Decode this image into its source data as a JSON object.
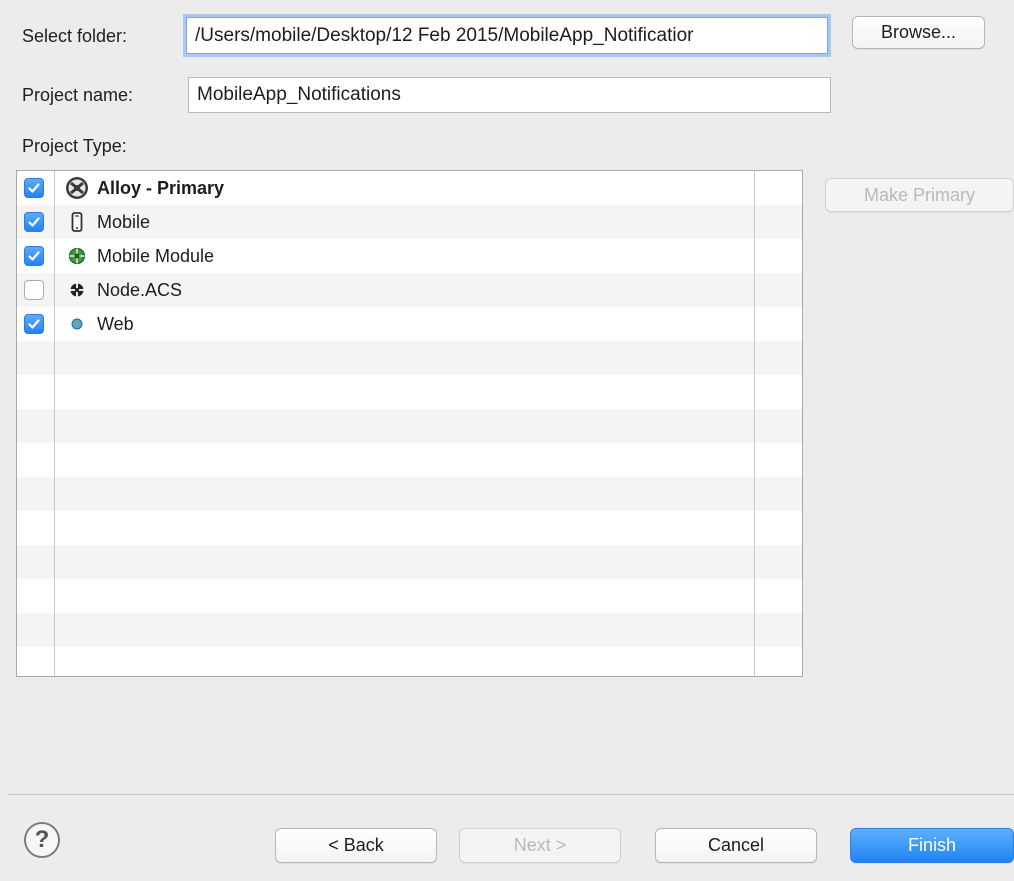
{
  "form": {
    "select_folder_label": "Select folder:",
    "folder_path": "/Users/mobile/Desktop/12 Feb 2015/MobileApp_Notificatior",
    "browse_label": "Browse...",
    "project_name_label": "Project name:",
    "project_name": "MobileApp_Notifications",
    "project_type_label": "Project Type:",
    "make_primary_label": "Make Primary"
  },
  "project_types": [
    {
      "label": "Alloy - Primary",
      "checked": true,
      "icon": "alloy-icon",
      "bold": true
    },
    {
      "label": "Mobile",
      "checked": true,
      "icon": "mobile-phone-icon",
      "bold": false
    },
    {
      "label": "Mobile Module",
      "checked": true,
      "icon": "mobile-module-icon",
      "bold": false
    },
    {
      "label": "Node.ACS",
      "checked": false,
      "icon": "node-acs-icon",
      "bold": false
    },
    {
      "label": "Web",
      "checked": true,
      "icon": "web-globe-icon",
      "bold": false
    }
  ],
  "footer": {
    "back_label": "< Back",
    "next_label": "Next >",
    "cancel_label": "Cancel",
    "finish_label": "Finish",
    "help_glyph": "?"
  },
  "colors": {
    "accent": "#1e82f7",
    "focus_ring": "#a8c7f2",
    "window_bg": "#ececec"
  }
}
